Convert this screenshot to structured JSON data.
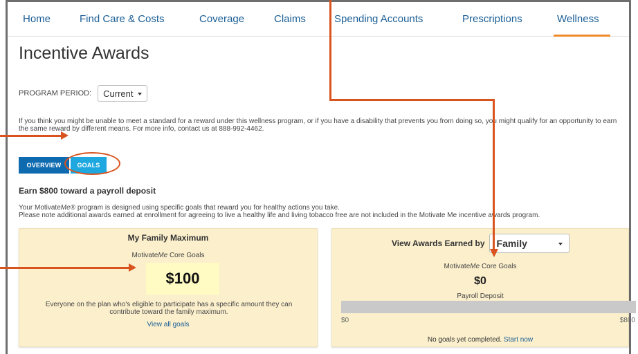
{
  "nav": {
    "items": [
      {
        "label": "Home"
      },
      {
        "label": "Find Care & Costs"
      },
      {
        "label": "Coverage"
      },
      {
        "label": "Claims"
      },
      {
        "label": "Spending Accounts"
      },
      {
        "label": "Prescriptions"
      },
      {
        "label": "Wellness"
      }
    ],
    "active": "Wellness"
  },
  "page": {
    "title": "Incentive Awards"
  },
  "period": {
    "label": "PROGRAM PERIOD:",
    "selected": "Current"
  },
  "notice": "If you think you might be unable to meet a standard for a reward under this wellness program, or if you have a disability that prevents you from doing so, you might qualify for an opportunity to earn the same reward by different means. For more info, contact us at 888-992-4462.",
  "tabs": [
    {
      "label": "OVERVIEW"
    },
    {
      "label": "GOALS"
    }
  ],
  "earn_heading": "Earn $800 toward a payroll deposit",
  "intro": {
    "line1_pre": "Your Motivate",
    "line1_em": "Me",
    "line1_post": "® program is designed using specific goals that reward you for healthy actions you take.",
    "line2": "Please note additional awards earned at enrollment for agreeing to live a healthy life and living tobacco free are not included in the Motivate Me incentive awards program."
  },
  "family_card": {
    "title": "My Family Maximum",
    "core_pre": "Motivate",
    "core_em": "Me",
    "core_post": " Core Goals",
    "amount": "$100",
    "description": "Everyone on the plan who's eligible to participate has a specific amount they can contribute toward the family maximum.",
    "link": "View all goals"
  },
  "awards_card": {
    "view_label": "View Awards Earned by",
    "view_selected": "Family",
    "core_pre": "Motivate",
    "core_em": "Me",
    "core_post": " Core Goals",
    "amount": "$0",
    "deposit_label": "Payroll Deposit",
    "progress_fraction": 0,
    "range_min": "$0",
    "range_max": "$800",
    "status_text": "No goals yet completed.",
    "start_link": "Start now"
  },
  "colors": {
    "link_blue": "#1a5e96",
    "active_underline": "#ef8a2c",
    "card_bg": "#fbefcc",
    "annotation": "#d9531e",
    "tab_overview": "#0e6bb0",
    "tab_goals": "#1fa8e0"
  }
}
